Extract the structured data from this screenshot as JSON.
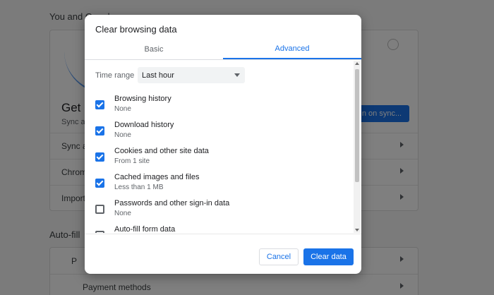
{
  "background": {
    "section_you_and_google": "You and Google",
    "sync_card": {
      "heading": "Get G",
      "subtext": "Sync ar",
      "sync_button": "n on sync...",
      "rows": [
        "Sync an",
        "Chrome",
        "Import"
      ]
    },
    "section_autofill": "Auto-fill",
    "autofill_rows": [
      "P",
      "Payment methods"
    ]
  },
  "dialog": {
    "title": "Clear browsing data",
    "tabs": [
      {
        "label": "Basic",
        "active": false
      },
      {
        "label": "Advanced",
        "active": true
      }
    ],
    "time_range": {
      "label": "Time range",
      "selected": "Last hour"
    },
    "items": [
      {
        "label": "Browsing history",
        "sub": "None",
        "checked": true
      },
      {
        "label": "Download history",
        "sub": "None",
        "checked": true
      },
      {
        "label": "Cookies and other site data",
        "sub": "From 1 site",
        "checked": true
      },
      {
        "label": "Cached images and files",
        "sub": "Less than 1 MB",
        "checked": true
      },
      {
        "label": "Passwords and other sign-in data",
        "sub": "None",
        "checked": false
      },
      {
        "label": "Auto-fill form data",
        "sub": "",
        "checked": false
      }
    ],
    "buttons": {
      "cancel": "Cancel",
      "clear": "Clear data"
    }
  },
  "colors": {
    "accent": "#1a73e8",
    "overlay": "rgba(0,0,0,0.5)"
  }
}
